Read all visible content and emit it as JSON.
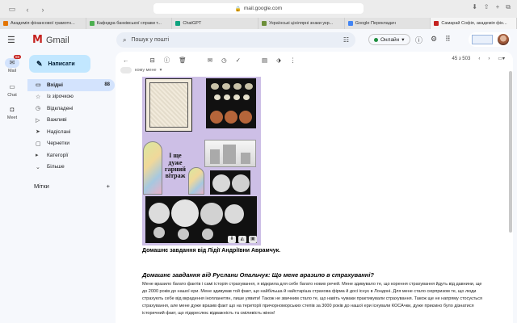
{
  "browser": {
    "url": "mail.google.com",
    "tabs": [
      {
        "label": "Академія фінансової грамотн...",
        "color": "#e37400",
        "active": false
      },
      {
        "label": "Кафедра банківської справи т...",
        "color": "#4caf50",
        "active": false
      },
      {
        "label": "ChatGPT",
        "color": "#10a37f",
        "active": false
      },
      {
        "label": "Українські цінілярні знаки укр...",
        "color": "#6d8f3a",
        "active": false
      },
      {
        "label": "Google Перекладач",
        "color": "#4285f4",
        "active": false
      },
      {
        "label": "Самарай Софія, академія фін...",
        "color": "#c5221f",
        "active": true
      }
    ]
  },
  "gmail": {
    "app_name": "Gmail",
    "search_placeholder": "Пошук у пошті",
    "status_label": "Онлайн",
    "compose_label": "Написати"
  },
  "rail": [
    {
      "label": "Mail",
      "badge": "88",
      "icon": "mail-icon"
    },
    {
      "label": "Chat",
      "icon": "chat-icon"
    },
    {
      "label": "Meet",
      "icon": "video-icon"
    }
  ],
  "nav": [
    {
      "label": "Вхідні",
      "count": "88",
      "icon": "inbox-icon",
      "active": true
    },
    {
      "label": "Із зірочкою",
      "count": "",
      "icon": "star-icon"
    },
    {
      "label": "Відкладені",
      "count": "",
      "icon": "clock-icon"
    },
    {
      "label": "Важливі",
      "count": "",
      "icon": "label-important-icon"
    },
    {
      "label": "Надіслані",
      "count": "",
      "icon": "send-icon"
    },
    {
      "label": "Чернетки",
      "count": "",
      "icon": "draft-icon"
    },
    {
      "label": "Категорії",
      "count": "",
      "icon": "category-icon"
    },
    {
      "label": "Більше",
      "count": "",
      "icon": "chevron-down-icon"
    }
  ],
  "labels_heading": "Мітки",
  "toolbar": {
    "pager": "45 з 503"
  },
  "message": {
    "to_line": "кому мене",
    "collage_caption": "І ще дуже гарний вітраж",
    "homework_1": "Домашнє завдання від Лідії Андріївни Аврамчук.",
    "homework_2": "Домашнє завдання від Руслани Опальчук: Що мене вразило в страхуванні?",
    "paragraph": "Мене вразило багато фактів і самі історія страхування, я відкрила для себе багато нових речей. Мене здивувало те, що корення страхування йдуть від давнини, ще до 2000 років до нашої ери. Мене здивував той факт, що найбільша й найстаріша страхова фірма й досі існує в Лондоні. Для мене стало сюрпризом те, що люди страхують себе від вкрадення інопланетян, лише уявити! Також не звичним стало те, що навіть чумаки практикували страхування. Також ще не напряму стосується страхування, але мене дуже вразив факт що на території причорноморських степів за 3000 років до нашої ери існували КОСАчки, дуже приємно було дізнатися історичний факт, що підкреслює відважність та сміливість жінок!"
  }
}
